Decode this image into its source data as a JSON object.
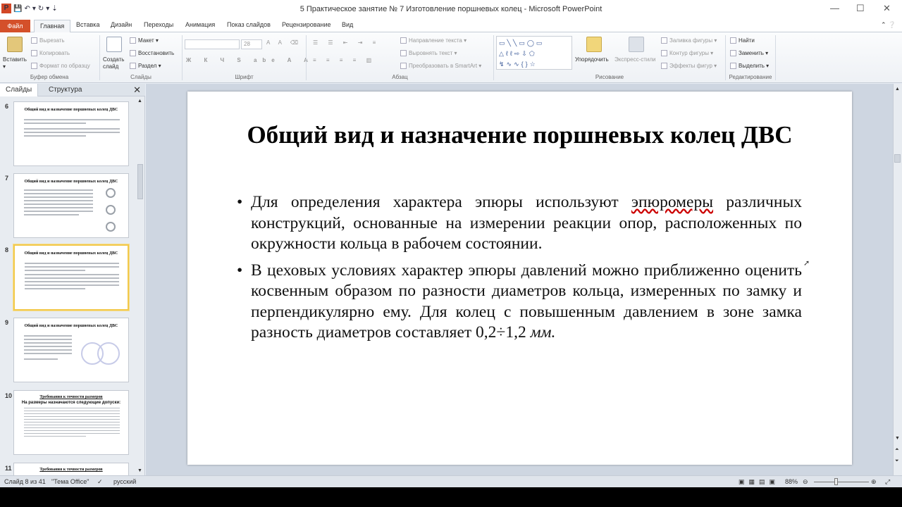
{
  "window": {
    "title": "5 Практическое занятие  № 7 Изготовление поршневых колец - Microsoft PowerPoint",
    "minimize": "—",
    "maximize": "☐",
    "close": "✕"
  },
  "tabs": {
    "file": "Файл",
    "items": [
      "Главная",
      "Вставка",
      "Дизайн",
      "Переходы",
      "Анимация",
      "Показ слайдов",
      "Рецензирование",
      "Вид"
    ]
  },
  "ribbon": {
    "clipboard": {
      "paste": "Вставить",
      "cut": "Вырезать",
      "copy": "Копировать",
      "format_painter": "Формат по образцу",
      "label": "Буфер обмена"
    },
    "slides": {
      "new_slide": "Создать слайд",
      "layout": "Макет",
      "reset": "Восстановить",
      "section": "Раздел",
      "label": "Слайды"
    },
    "font": {
      "size": "28",
      "label": "Шрифт"
    },
    "paragraph": {
      "text_direction": "Направление текста",
      "align_text": "Выровнять текст",
      "smartart": "Преобразовать в SmartArt",
      "label": "Абзац"
    },
    "drawing": {
      "arrange": "Упорядочить",
      "quick_styles": "Экспресс-стили",
      "shape_fill": "Заливка фигуры",
      "shape_outline": "Контур фигуры",
      "shape_effects": "Эффекты фигур",
      "label": "Рисование"
    },
    "editing": {
      "find": "Найти",
      "replace": "Заменить",
      "select": "Выделить",
      "label": "Редактирование"
    }
  },
  "panel": {
    "tab_slides": "Слайды",
    "tab_outline": "Структура",
    "thumbnails": [
      {
        "num": "6",
        "title": "Общий вид и назначение поршневых колец ДВС"
      },
      {
        "num": "7",
        "title": "Общий вид и назначение поршневых колец ДВС"
      },
      {
        "num": "8",
        "title": "Общий вид и назначение поршневых колец ДВС"
      },
      {
        "num": "9",
        "title": "Общий вид и назначение поршневых колец ДВС"
      },
      {
        "num": "10",
        "title": "Требования к точности размеров",
        "subtitle": "На размеры назначаются следующие допуски:"
      },
      {
        "num": "11",
        "title": "Требования к точности размеров"
      }
    ]
  },
  "slide": {
    "title": "Общий вид и назначение поршневых колец ДВС",
    "bullet1_pre": "Для определения характера эпюры используют ",
    "bullet1_term": "эпюромеры",
    "bullet1_post": " различных конструкций, основанные на измерении реакции опор, расположенных по окружности кольца в рабочем состоянии.",
    "bullet2_pre": "В цеховых условиях характер эпюры давлений можно приближенно оценить косвенным образом по разности диаметров кольца, измеренных по замку и перпендикулярно ему. Для колец с повышенным давлением в зоне замка разность диаметров составляет 0,2÷1,2 ",
    "bullet2_unit": "мм."
  },
  "status": {
    "slide_info": "Слайд 8 из 41",
    "theme": "\"Тема Office\"",
    "language": "русский",
    "zoom": "88%"
  }
}
